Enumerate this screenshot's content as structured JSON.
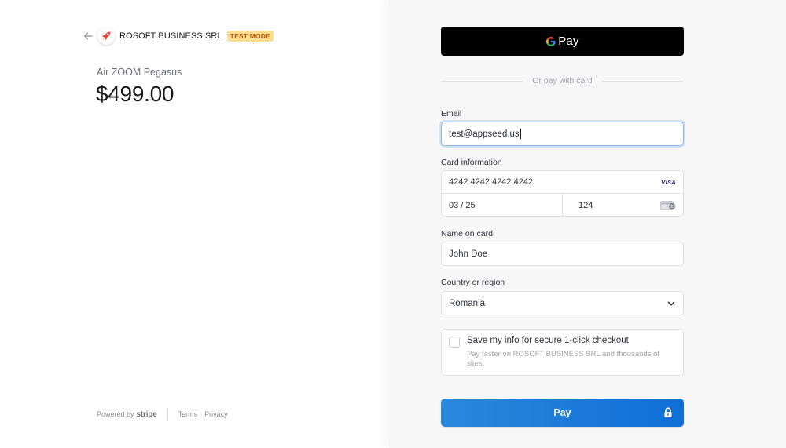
{
  "merchant": {
    "name": "ROSOFT BUSINESS SRL",
    "badge": "TEST MODE"
  },
  "product": {
    "name": "Air ZOOM Pegasus",
    "price": "$499.00"
  },
  "footer": {
    "powered_by": "Powered by",
    "stripe": "stripe",
    "terms": "Terms",
    "privacy": "Privacy"
  },
  "payment": {
    "gpay_label": "Pay",
    "divider": "Or pay with card",
    "email_label": "Email",
    "email_value": "test@appseed.us",
    "card_label": "Card information",
    "card_number": "4242 4242 4242 4242",
    "card_brand": "VISA",
    "expiry": "03 / 25",
    "cvc": "124",
    "name_label": "Name on card",
    "name_value": "John Doe",
    "country_label": "Country or region",
    "country_value": "Romania",
    "save_title": "Save my info for secure 1-click checkout",
    "save_desc": "Pay faster on ROSOFT BUSINESS SRL and thousands of sites.",
    "pay_button": "Pay"
  },
  "colors": {
    "pay_button": "#1572d9",
    "badge_bg": "#ffde92",
    "badge_text": "#bb5504",
    "gpay_bg": "#000000"
  },
  "icons": {
    "back": "arrow-left-icon",
    "logo": "rocket-icon",
    "google": "google-g-icon",
    "card_cvc": "card-cvc-icon",
    "dropdown": "chevron-down-icon",
    "lock": "lock-icon"
  }
}
